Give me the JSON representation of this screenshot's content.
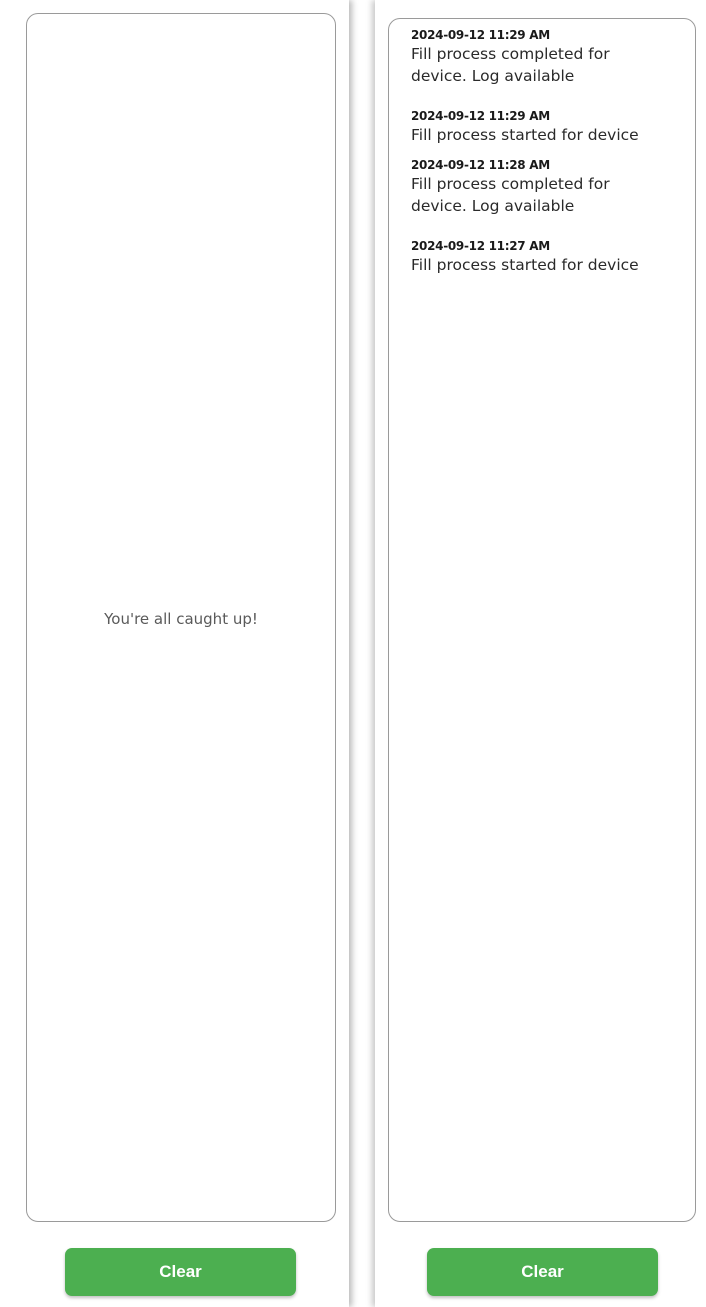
{
  "left_panel": {
    "empty_message": "You're all caught up!",
    "clear_label": "Clear"
  },
  "right_panel": {
    "notifications": [
      {
        "timestamp": "2024-09-12 11:29 AM",
        "message_lines": [
          "Fill process completed for",
          "device. Log available"
        ]
      },
      {
        "timestamp": "2024-09-12 11:29 AM",
        "message_lines": [
          "Fill process started for device"
        ]
      },
      {
        "timestamp": "2024-09-12 11:28 AM",
        "message_lines": [
          "Fill process completed for",
          "device. Log available"
        ]
      },
      {
        "timestamp": "2024-09-12 11:27 AM",
        "message_lines": [
          "Fill process started for device"
        ]
      }
    ],
    "clear_label": "Clear"
  },
  "colors": {
    "accent_green": "#4caf50",
    "border": "#9a9a9a",
    "text_muted": "#5a5a5a"
  }
}
